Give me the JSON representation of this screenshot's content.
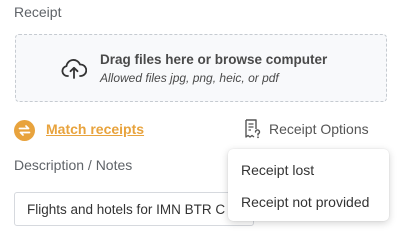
{
  "receipt_section": {
    "label": "Receipt",
    "dropzone": {
      "title": "Drag files here or browse computer",
      "subtitle": "Allowed files jpg, png, heic, or pdf",
      "icon": "cloud-upload-icon"
    }
  },
  "actions": {
    "match_receipts_label": "Match receipts",
    "match_icon": "swap-arrows-icon",
    "receipt_options_label": "Receipt Options",
    "receipt_options_icon": "receipt-question-icon"
  },
  "description": {
    "label": "Description / Notes",
    "value": "Flights and hotels for IMN BTR C"
  },
  "receipt_options_menu": {
    "items": [
      "Receipt lost",
      "Receipt not provided"
    ]
  },
  "colors": {
    "accent": "#e8a33d",
    "label_gray": "#5f6368",
    "dropzone_bg": "#f8f9fb"
  }
}
